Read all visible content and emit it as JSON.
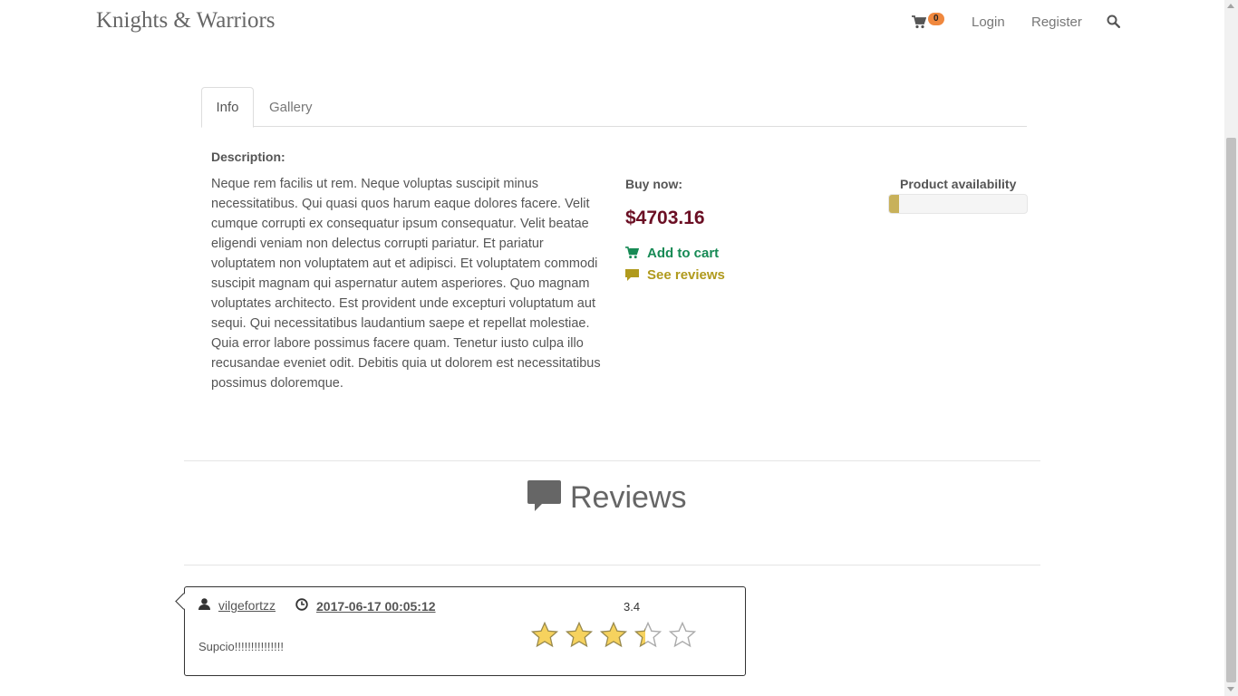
{
  "header": {
    "brand": "Knights & Warriors",
    "cart_count": "0",
    "login": "Login",
    "register": "Register"
  },
  "tabs": [
    {
      "label": "Info",
      "active": true
    },
    {
      "label": "Gallery",
      "active": false
    }
  ],
  "product": {
    "description_title": "Description:",
    "description": "Neque rem facilis ut rem. Neque voluptas suscipit minus necessitatibus. Qui quasi quos harum eaque dolores facere. Velit cumque corrupti ex consequatur ipsum consequatur. Velit beatae eligendi veniam non delectus corrupti pariatur. Et pariatur voluptatem non voluptatem aut et adipisci. Et voluptatem commodi suscipit magnam qui aspernatur autem asperiores. Quo magnam voluptates architecto. Est provident unde excepturi voluptatum aut sequi. Qui necessitatibus laudantium saepe et repellat molestiae. Quia error labore possimus facere quam. Tenetur iusto culpa illo recusandae eveniet odit. Debitis quia ut dolorem est necessitatibus possimus doloremque.",
    "buy_label": "Buy now:",
    "price": "$4703.16",
    "add_to_cart": "Add to cart",
    "see_reviews": "See reviews",
    "availability_label": "Product availability",
    "availability_fraction": 0.07
  },
  "reviews": {
    "title": "Reviews",
    "items": [
      {
        "user": "vilgefortzz",
        "date": "2017-06-17 00:05:12",
        "score": "3.4",
        "rating": 3.4,
        "text": "Supcio!!!!!!!!!!!!!!!"
      }
    ]
  },
  "colors": {
    "price": "#6b0f24",
    "add_to_cart": "#178a55",
    "see_reviews": "#b09a1d",
    "cart_badge": "#f0883e",
    "star_fill": "#f6d25e",
    "availability_fill": "#c8b15a"
  },
  "icons": [
    "cart-icon",
    "search-icon",
    "comment-icon",
    "user-icon",
    "clock-icon",
    "star-icon"
  ]
}
